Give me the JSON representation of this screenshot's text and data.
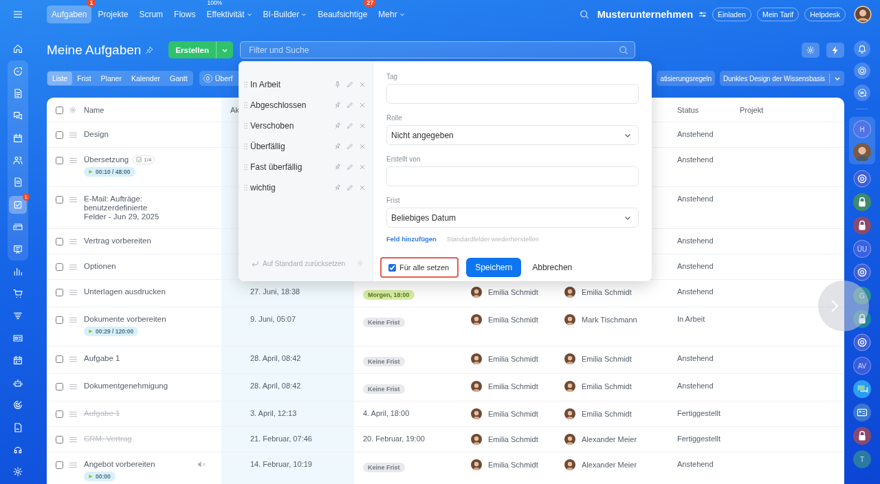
{
  "topbar": {
    "tabs": [
      {
        "label": "Aufgaben",
        "selected": true,
        "badge": "1"
      },
      {
        "label": "Projekte",
        "selected": false
      },
      {
        "label": "Scrum",
        "selected": false
      },
      {
        "label": "Flows",
        "selected": false
      },
      {
        "label": "Effektivität",
        "selected": false,
        "caret": true,
        "superscript": "100%"
      },
      {
        "label": "BI-Builder",
        "selected": false,
        "caret": true
      },
      {
        "label": "Beaufsichtige",
        "selected": false,
        "badge": "27"
      },
      {
        "label": "Mehr",
        "selected": false,
        "caret": true
      }
    ],
    "company": "Musterunternehmen",
    "buttons": [
      "Einladen",
      "Mein Tarif",
      "Helpdesk"
    ]
  },
  "left_sidebar": {
    "items": [
      {
        "selected": false
      },
      {
        "selected": false
      },
      {
        "selected": false
      },
      {
        "selected": false
      },
      {
        "selected": false
      },
      {
        "selected": false
      },
      {
        "selected": false
      },
      {
        "selected": true,
        "badge": "1"
      },
      {
        "selected": false
      },
      {
        "selected": false
      },
      {
        "selected": false
      },
      {
        "selected": false
      },
      {
        "selected": false
      },
      {
        "selected": false
      },
      {
        "selected": false
      },
      {
        "selected": false
      },
      {
        "selected": false
      },
      {
        "selected": false
      },
      {
        "selected": false
      },
      {
        "selected": false
      }
    ]
  },
  "header": {
    "title": "Meine Aufgaben",
    "create_button": "Erstellen",
    "search": {
      "placeholder": "Filter und Suche"
    }
  },
  "toolbar": {
    "view_tabs": [
      {
        "label": "Liste",
        "selected": true
      },
      {
        "label": "Frist",
        "selected": false
      },
      {
        "label": "Planer",
        "selected": false
      },
      {
        "label": "Kalender",
        "selected": false
      },
      {
        "label": "Gantt",
        "selected": false
      }
    ],
    "counter": {
      "count": "0",
      "label": "Überf"
    },
    "buttons": [
      {
        "label": "atisierungsregeln",
        "caret": false
      },
      {
        "label": "Dunkles Design der Wissensbasis",
        "caret": true
      }
    ]
  },
  "table": {
    "select_all_checked": false,
    "columns": [
      {
        "label": "Name"
      },
      {
        "label": "Ak"
      },
      {
        "label": "Status"
      },
      {
        "label": "Projekt"
      }
    ],
    "rows": [
      {
        "name": "Design",
        "checked": false,
        "done": false,
        "status": "Anstehend"
      },
      {
        "name": "Übersetzung",
        "checked": false,
        "done": false,
        "checklist": "1/4",
        "timer": "00:10 / 48:00",
        "status": "Anstehend"
      },
      {
        "name": "E-Mail: Aufträge:\nbenutzerdefinierte\nFelder - Jun 29, 2025",
        "checked": false,
        "done": false,
        "status": "Anstehend"
      },
      {
        "name": "Vertrag vorbereiten",
        "checked": false,
        "done": false,
        "status": "Anstehend"
      },
      {
        "name": "Optionen",
        "checked": false,
        "done": false,
        "status": "Anstehend"
      },
      {
        "name": "Unterlagen ausdrucken",
        "checked": false,
        "done": false,
        "activity": "27. Juni, 18:38",
        "deadline": {
          "kind": "soon",
          "text": "Morgen, 18:00"
        },
        "creator": "Emilia Schmidt",
        "responsible": "Emilia Schmidt",
        "status": "Anstehend"
      },
      {
        "name": "Dokumente vorbereiten",
        "checked": false,
        "done": false,
        "timer": "00:29 / 120:00",
        "activity": "9. Juni, 05:07",
        "deadline": {
          "kind": "none",
          "text": "Keine Frist"
        },
        "creator": "Emilia Schmidt",
        "responsible": "Mark Tischmann",
        "status": "In Arbeit"
      },
      {
        "name": "Aufgabe 1",
        "checked": false,
        "done": false,
        "activity": "28. April, 08:42",
        "deadline": {
          "kind": "none",
          "text": "Keine Frist"
        },
        "creator": "Emilia Schmidt",
        "responsible": "Emilia Schmidt",
        "status": "Anstehend"
      },
      {
        "name": "Dokumentgenehmigung",
        "checked": false,
        "done": false,
        "activity": "28. April, 08:42",
        "deadline": {
          "kind": "none",
          "text": "Keine Frist"
        },
        "creator": "Emilia Schmidt",
        "responsible": "Emilia Schmidt",
        "status": "Anstehend"
      },
      {
        "name": "Aufgabe 1",
        "checked": false,
        "done": true,
        "activity": "3. April, 12:13",
        "deadline": {
          "kind": "date",
          "text": "4. April, 18:00"
        },
        "creator": "Emilia Schmidt",
        "responsible": "Emilia Schmidt",
        "status": "Fertiggestellt"
      },
      {
        "name": "CRM: Vertrag",
        "checked": false,
        "done": true,
        "activity": "21. Februar, 07:46",
        "deadline": {
          "kind": "date",
          "text": "20. Februar, 19:00"
        },
        "creator": "Emilia Schmidt",
        "responsible": "Alexander Meier",
        "status": "Fertiggestellt"
      },
      {
        "name": "Angebot vorbereiten",
        "checked": false,
        "done": false,
        "muted": true,
        "timer": "00:00",
        "activity": "14. Februar, 10:19",
        "deadline": {
          "kind": "none",
          "text": "Keine Frist"
        },
        "creator": "Emilia Schmidt",
        "responsible": "Alexander Meier",
        "status": "Anstehend"
      }
    ]
  },
  "filter_popup": {
    "presets": [
      {
        "label": "In Arbeit",
        "pinned": true
      },
      {
        "label": "Abgeschlossen",
        "pinned": false
      },
      {
        "label": "Verschoben",
        "pinned": false
      },
      {
        "label": "Überfällig",
        "pinned": false
      },
      {
        "label": "Fast überfällig",
        "pinned": false
      },
      {
        "label": "wichtig",
        "pinned": false
      }
    ],
    "reset": "Auf Standard zurücksetzen",
    "fields": [
      {
        "label": "Tag",
        "kind": "input"
      },
      {
        "label": "Rolle",
        "kind": "select",
        "value": "Nicht angegeben"
      },
      {
        "label": "Erstellt von",
        "kind": "input"
      },
      {
        "label": "Frist",
        "kind": "select",
        "value": "Beliebiges Datum"
      }
    ],
    "add_field": "Feld hinzufügen",
    "restore_fields": "Standardfelder wiederherstellen",
    "for_all": {
      "label": "Für alle setzen",
      "checked": true,
      "highlighted": true
    },
    "save": "Speichern",
    "cancel": "Abbrechen"
  },
  "right_sidebar": {
    "pinned_chats": [
      {
        "kind": "letter",
        "label": "H"
      },
      {
        "kind": "photo"
      }
    ],
    "chats": [
      {
        "kind": "spiral"
      },
      {
        "kind": "lock",
        "color": "#3d8a6e"
      },
      {
        "kind": "lock",
        "color": "#8a4a70"
      },
      {
        "kind": "letter",
        "label": "ÜU"
      },
      {
        "kind": "spiral"
      },
      {
        "kind": "letter",
        "label": "G",
        "color": "#2e8d9e"
      },
      {
        "kind": "lock",
        "color": "#1d86a6"
      },
      {
        "kind": "spiral"
      },
      {
        "kind": "letter",
        "label": "AV"
      },
      {
        "kind": "chat",
        "color": "#2a9ff2"
      },
      {
        "kind": "card",
        "color": "#3a78d0"
      },
      {
        "kind": "lock",
        "color": "#8a4a70"
      },
      {
        "kind": "letter",
        "label": "T",
        "color": "#2a7aa6"
      }
    ]
  }
}
